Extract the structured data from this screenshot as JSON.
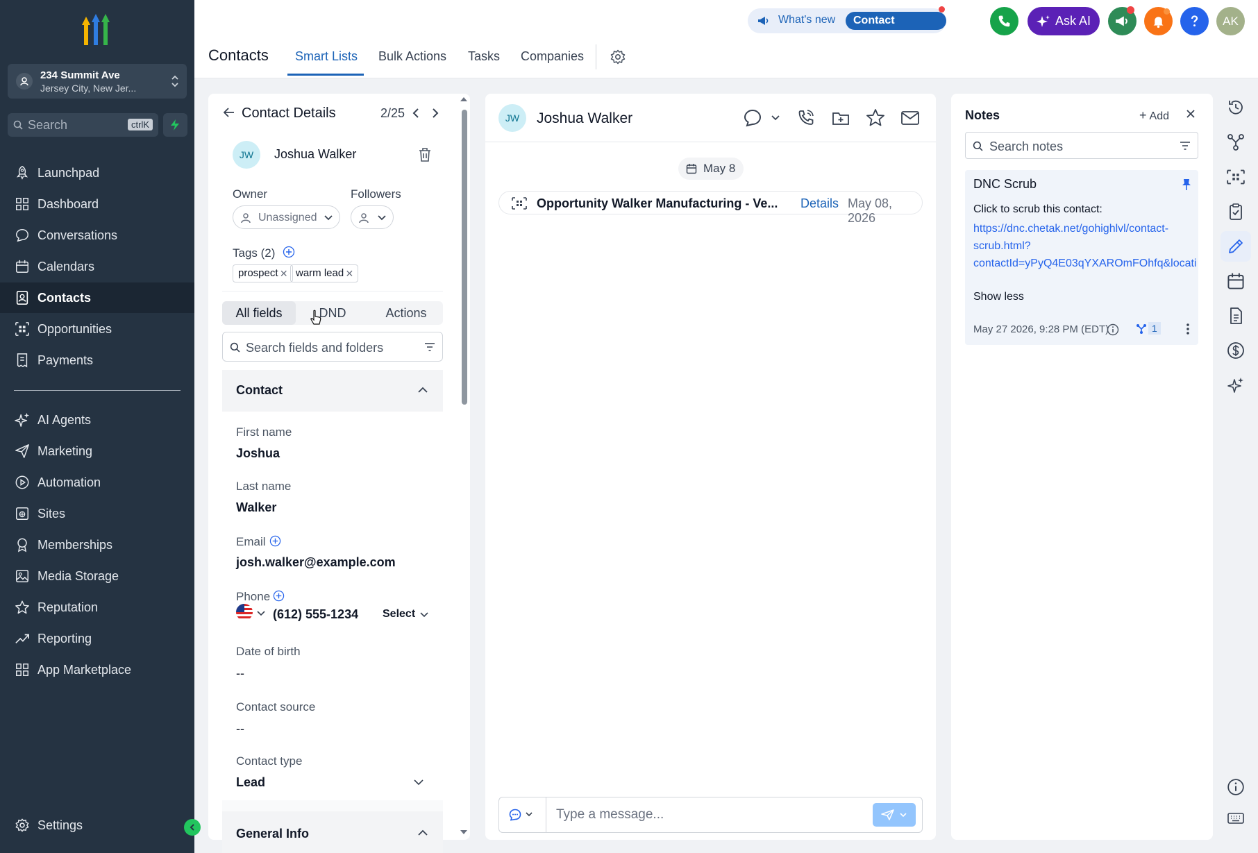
{
  "sidebar": {
    "location": {
      "name": "234 Summit Ave",
      "address": "Jersey City, New Jer..."
    },
    "search": {
      "placeholder": "Search",
      "shortcut": "ctrlK"
    },
    "nav_items": [
      {
        "label": "Launchpad",
        "icon": "rocket-icon"
      },
      {
        "label": "Dashboard",
        "icon": "grid-icon"
      },
      {
        "label": "Conversations",
        "icon": "chat-icon"
      },
      {
        "label": "Calendars",
        "icon": "calendar-icon"
      },
      {
        "label": "Contacts",
        "icon": "contacts-icon",
        "active": true
      },
      {
        "label": "Opportunities",
        "icon": "opportunities-icon"
      },
      {
        "label": "Payments",
        "icon": "receipt-icon"
      },
      {
        "label": "AI Agents",
        "icon": "sparkle-icon"
      },
      {
        "label": "Marketing",
        "icon": "send-icon"
      },
      {
        "label": "Automation",
        "icon": "automation-icon"
      },
      {
        "label": "Sites",
        "icon": "globe-icon"
      },
      {
        "label": "Memberships",
        "icon": "award-icon"
      },
      {
        "label": "Media Storage",
        "icon": "image-icon"
      },
      {
        "label": "Reputation",
        "icon": "star-icon"
      },
      {
        "label": "Reporting",
        "icon": "trend-icon"
      },
      {
        "label": "App Marketplace",
        "icon": "apps-icon"
      }
    ],
    "settings_label": "Settings"
  },
  "header": {
    "title": "Contacts",
    "tabs": [
      {
        "label": "Smart Lists",
        "active": true
      },
      {
        "label": "Bulk Actions"
      },
      {
        "label": "Tasks"
      },
      {
        "label": "Companies"
      }
    ],
    "whats_new": "What's new",
    "contact_updates": "Contact updates",
    "ask_ai": "Ask AI",
    "avatar_initials": "AK",
    "colors": {
      "accent": "#1c63b7",
      "phone": "#16a34a",
      "ai": "#5b21b6",
      "notify": "#f97316",
      "help": "#2563eb",
      "avatar": "#a3b18a"
    }
  },
  "contact_details": {
    "title": "Contact Details",
    "position": "2/25",
    "initials": "JW",
    "name": "Joshua Walker",
    "owner_label": "Owner",
    "owner_value": "Unassigned",
    "followers_label": "Followers",
    "tags_label": "Tags (2)",
    "tags": [
      "prospect",
      "warm lead"
    ],
    "subtabs": [
      "All fields",
      "DND",
      "Actions"
    ],
    "search_placeholder": "Search fields and folders",
    "section_contact": "Contact",
    "fields": {
      "first_name_label": "First name",
      "first_name": "Joshua",
      "last_name_label": "Last name",
      "last_name": "Walker",
      "email_label": "Email",
      "email": "josh.walker@example.com",
      "phone_label": "Phone",
      "phone": "(612) 555-1234",
      "phone_type": "Select",
      "dob_label": "Date of birth",
      "dob": "--",
      "source_label": "Contact source",
      "source": "--",
      "type_label": "Contact type",
      "type": "Lead"
    },
    "section_general": "General Info"
  },
  "conversation": {
    "initials": "JW",
    "name": "Joshua Walker",
    "date_chip": "May 8",
    "activity": {
      "title": "Opportunity Walker Manufacturing - Ve...",
      "link": "Details",
      "date": "May 08, 2026"
    },
    "composer_placeholder": "Type a message..."
  },
  "notes": {
    "title": "Notes",
    "add_label": "Add",
    "search_placeholder": "Search notes",
    "note": {
      "title": "DNC Scrub",
      "body": "Click to scrub this contact:",
      "link_line1": "https://dnc.chetak.net/gohighlvl/contact-",
      "link_line2": "scrub.html?",
      "link_line3": "contactId=yPyQ4E03qYXAROmFOhfq&locati",
      "toggle": "Show less",
      "timestamp": "May 27 2026, 9:28 PM (EDT)",
      "count": "1"
    }
  }
}
